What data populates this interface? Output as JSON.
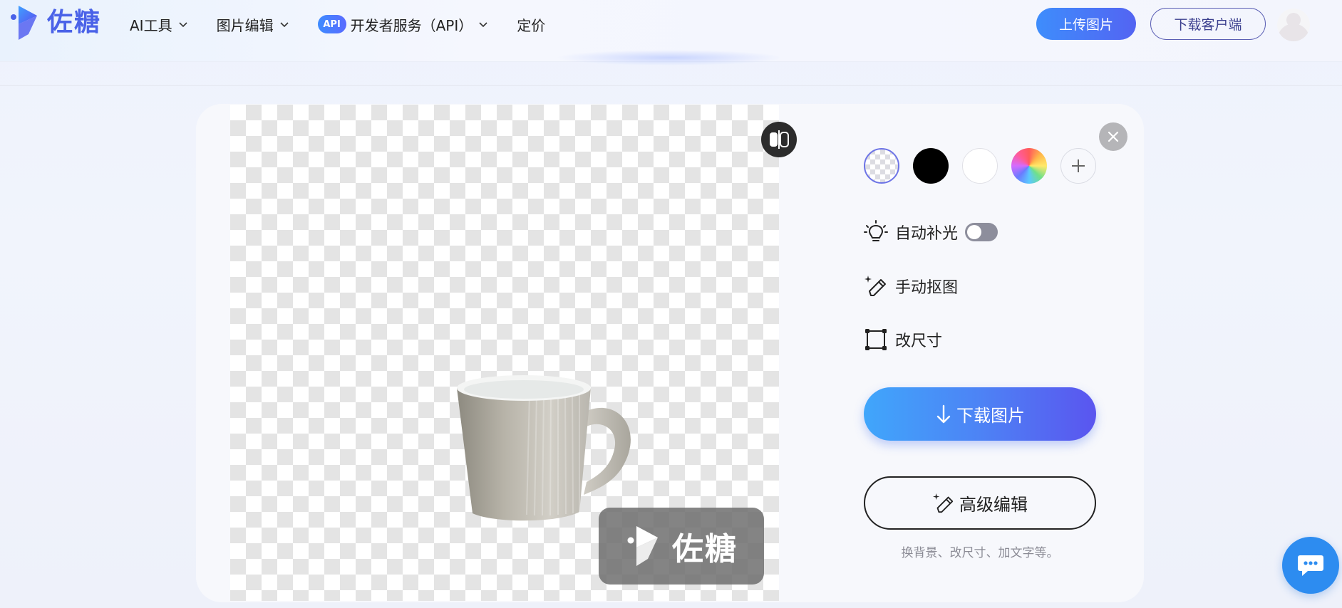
{
  "header": {
    "brand": "佐糖",
    "nav": [
      {
        "label": "AI工具",
        "has_dropdown": true
      },
      {
        "label": "图片编辑",
        "has_dropdown": true
      },
      {
        "label": "开发者服务（API）",
        "badge": "API",
        "has_dropdown": true
      },
      {
        "label": "定价",
        "has_dropdown": false
      }
    ],
    "upload_button": "上传图片",
    "client_button": "下载客户端"
  },
  "preview": {
    "watermark_text": "佐糖",
    "compare_icon": "compare-icon"
  },
  "panel": {
    "swatches": [
      {
        "name": "transparent",
        "selected": true
      },
      {
        "name": "black",
        "color": "#000000"
      },
      {
        "name": "white",
        "color": "#ffffff"
      },
      {
        "name": "custom-color"
      },
      {
        "name": "add"
      }
    ],
    "options": {
      "auto_light": {
        "label": "自动补光",
        "enabled": false
      },
      "manual_cutout": {
        "label": "手动抠图"
      },
      "resize": {
        "label": "改尺寸"
      }
    },
    "download_button": "下载图片",
    "advanced_button": "高级编辑",
    "hint": "换背景、改尺寸、加文字等。"
  },
  "colors": {
    "brand": "#4a62e8",
    "download_gradient_start": "#40a6fb",
    "download_gradient_end": "#5a55ef",
    "chat": "#2d8cf0"
  }
}
